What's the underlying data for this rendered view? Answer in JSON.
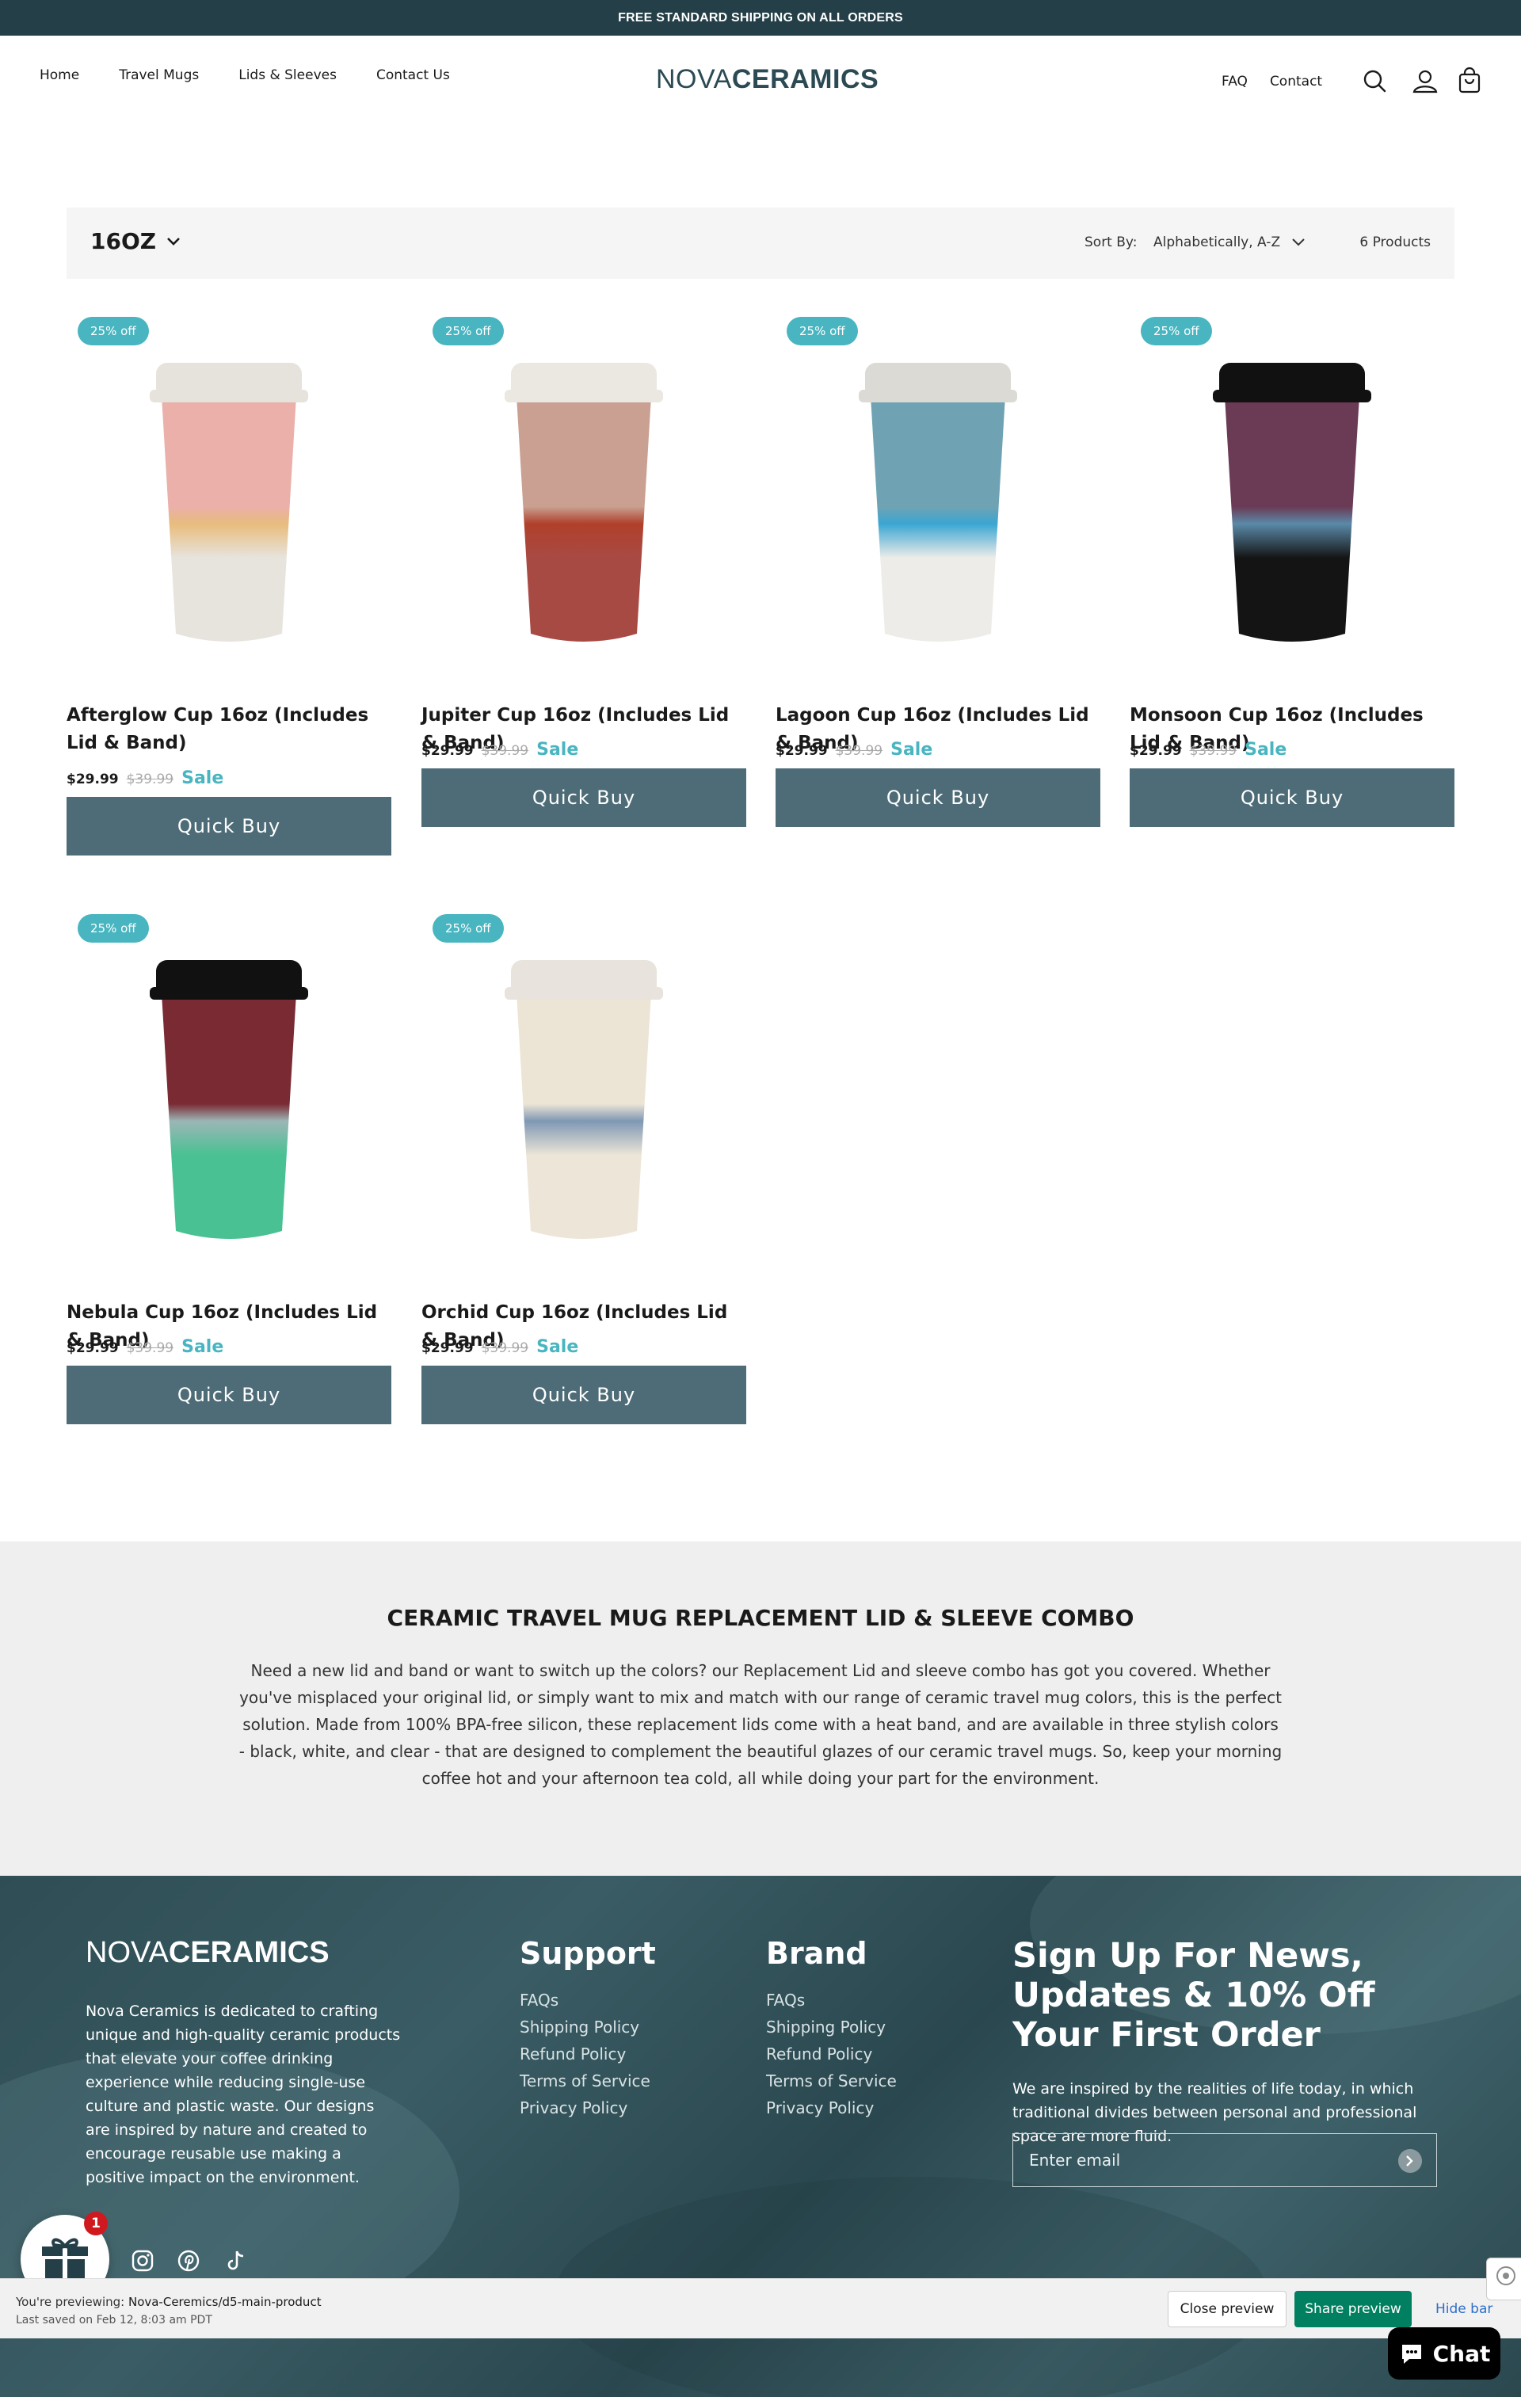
{
  "announcement": "FREE STANDARD SHIPPING ON ALL ORDERS",
  "brand": {
    "light": "NOVA",
    "bold": "CERAMICS",
    "color": "#2b4a53"
  },
  "nav_left": [
    "Home",
    "Travel Mugs",
    "Lids & Sleeves",
    "Contact Us"
  ],
  "nav_right": [
    "FAQ",
    "Contact"
  ],
  "header_icons": [
    "search-icon",
    "account-icon",
    "cart-icon"
  ],
  "toolbar": {
    "filter_title": "16OZ",
    "sort_label": "Sort By:",
    "sort_value": "Alphabetically, A-Z",
    "product_count": "6 Products"
  },
  "products": [
    {
      "badge": "25% off",
      "title": "Afterglow Cup 16oz (Includes Lid & Band)",
      "price": "$29.99",
      "compare": "$39.99",
      "sale": "Sale",
      "button": "Quick Buy",
      "lid": "#e6e2dc",
      "glaze_top": "#eab0a9",
      "glaze_band": "#e8bc7c",
      "glaze_base": "#e7e4de"
    },
    {
      "badge": "25% off",
      "title": "Jupiter Cup 16oz (Includes Lid & Band)",
      "price": "$29.99",
      "compare": "$39.99",
      "sale": "Sale",
      "button": "Quick Buy",
      "lid": "#ebe8e2",
      "glaze_top": "#c9a091",
      "glaze_band": "#b0402b",
      "glaze_base": "#a84a44"
    },
    {
      "badge": "25% off",
      "title": "Lagoon Cup 16oz (Includes Lid & Band)",
      "price": "$29.99",
      "compare": "$39.99",
      "sale": "Sale",
      "button": "Quick Buy",
      "lid": "#dcdad5",
      "glaze_top": "#6fa3b3",
      "glaze_band": "#3aa6d3",
      "glaze_base": "#eeece8"
    },
    {
      "badge": "25% off",
      "title": "Monsoon Cup 16oz (Includes Lid & Band)",
      "price": "$29.99",
      "compare": "$39.99",
      "sale": "Sale",
      "button": "Quick Buy",
      "lid": "#111111",
      "glaze_top": "#6b3a55",
      "glaze_band": "#5a8aa8",
      "glaze_base": "#141414"
    },
    {
      "badge": "25% off",
      "title": "Nebula Cup 16oz (Includes Lid & Band)",
      "price": "$29.99",
      "compare": "$39.99",
      "sale": "Sale",
      "button": "Quick Buy",
      "lid": "#111111",
      "glaze_top": "#7a2a33",
      "glaze_band": "#9bb6b6",
      "glaze_base": "#49c193"
    },
    {
      "badge": "25% off",
      "title": "Orchid Cup 16oz (Includes Lid & Band)",
      "price": "$29.99",
      "compare": "$39.99",
      "sale": "Sale",
      "button": "Quick Buy",
      "lid": "#e8e4dd",
      "glaze_top": "#ece5d6",
      "glaze_band": "#7f98b4",
      "glaze_base": "#ede6d8"
    }
  ],
  "info": {
    "heading": "CERAMIC TRAVEL MUG REPLACEMENT LID & SLEEVE COMBO",
    "body": "Need a new lid and band or want to switch up the colors? our Replacement Lid and sleeve combo has got you covered. Whether you've misplaced your original lid, or simply want to mix and match with our range of ceramic travel mug colors, this is the perfect solution. Made from 100% BPA-free silicon, these replacement lids come with a heat band, and are available in three stylish colors - black, white, and clear - that are designed to complement the beautiful glazes of our ceramic travel mugs. So, keep your morning coffee hot and your afternoon tea cold, all while doing your part for the environment."
  },
  "footer": {
    "description": "Nova Ceramics is dedicated to crafting unique and high-quality ceramic products that elevate your coffee drinking experience while reducing single-use culture and plastic waste. Our designs are inspired by nature and created to encourage reusable use making a positive impact on the environment.",
    "support": {
      "heading": "Support",
      "links": [
        "FAQs",
        "Shipping Policy",
        "Refund Policy",
        "Terms of Service",
        "Privacy Policy"
      ]
    },
    "brand_col": {
      "heading": "Brand",
      "links": [
        "FAQs",
        "Shipping Policy",
        "Refund Policy",
        "Terms of Service",
        "Privacy Policy"
      ]
    },
    "newsletter": {
      "heading": "Sign Up For News, Updates & 10% Off Your First Order",
      "text": "We are inspired by the realities of life today, in which traditional divides between personal and professional space are more fluid.",
      "placeholder": "Enter email"
    },
    "social": [
      "instagram-icon",
      "pinterest-icon",
      "tiktok-icon"
    ]
  },
  "gift_badge": "1",
  "preview": {
    "prefix": "You're previewing: ",
    "theme": "Nova-Ceremics/d5-main-product",
    "saved": "Last saved on Feb 12, 8:03 am PDT",
    "close": "Close preview",
    "share": "Share preview",
    "hide": "Hide bar"
  },
  "chat_label": "Chat",
  "colors": {
    "accent": "#48b5c0",
    "button": "#4e6c77",
    "dark": "#243f47",
    "share_green": "#008060"
  }
}
